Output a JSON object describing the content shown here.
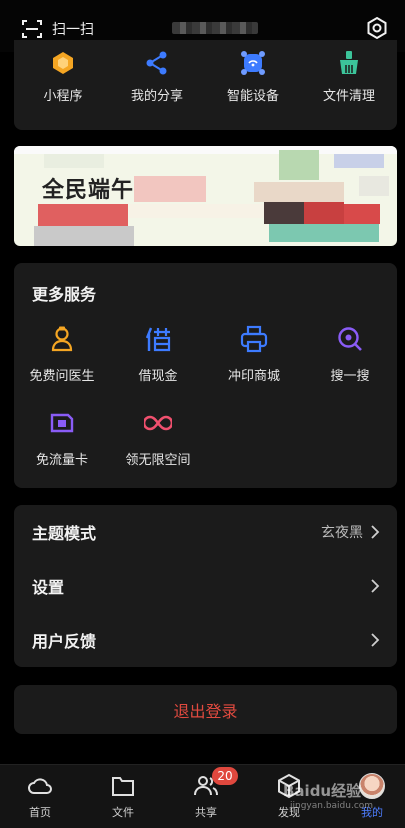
{
  "header": {
    "scan_label": "扫一扫"
  },
  "tools": [
    {
      "label": "小程序",
      "icon": "mini-program-icon",
      "color": "#f5a623"
    },
    {
      "label": "我的分享",
      "icon": "share-icon",
      "color": "#3d7bff"
    },
    {
      "label": "智能设备",
      "icon": "smart-device-icon",
      "color": "#3d7bff"
    },
    {
      "label": "文件清理",
      "icon": "broom-icon",
      "color": "#3cc49a"
    }
  ],
  "banner": {
    "title": "全民端午"
  },
  "services": {
    "title": "更多服务",
    "items": [
      {
        "label": "免费问医生",
        "icon": "doctor-icon",
        "color": "#f5a623"
      },
      {
        "label": "借现金",
        "icon": "borrow-icon",
        "color": "#3d7bff"
      },
      {
        "label": "冲印商城",
        "icon": "printer-icon",
        "color": "#3d7bff"
      },
      {
        "label": "搜一搜",
        "icon": "search-icon",
        "color": "#8a5cf6"
      },
      {
        "label": "免流量卡",
        "icon": "sim-card-icon",
        "color": "#8a5cf6"
      },
      {
        "label": "领无限空间",
        "icon": "infinity-icon",
        "color": "#f0506e"
      }
    ]
  },
  "settings": {
    "theme_label": "主题模式",
    "theme_value": "玄夜黑",
    "settings_label": "设置",
    "feedback_label": "用户反馈"
  },
  "logout_label": "退出登录",
  "tabbar": {
    "tabs": [
      {
        "label": "首页"
      },
      {
        "label": "文件"
      },
      {
        "label": "共享"
      },
      {
        "label": "发现"
      },
      {
        "label": "我的"
      }
    ],
    "share_badge": "20"
  },
  "watermark": {
    "main": "Baidu经验",
    "sub": "jingyan.baidu.com"
  },
  "colors": {
    "accent": "#4d7dff",
    "danger": "#e04a3f",
    "card": "#1b1b1b"
  }
}
